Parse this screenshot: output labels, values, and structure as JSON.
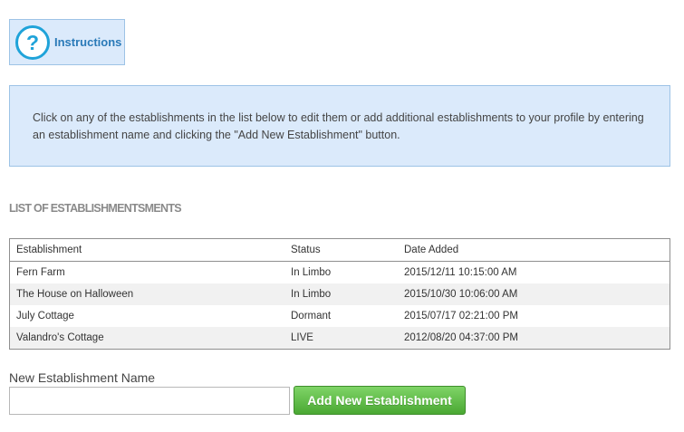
{
  "instructions": {
    "label": "Instructions",
    "icon": "help-question-icon"
  },
  "info_panel": {
    "text": "Click on any of the establishments in the list below to edit them or add additional establishments to your profile by entering an establishment name and clicking the \"Add New Establishment\" button."
  },
  "section_title": "LIST OF ESTABLISHMENTSMENTS",
  "table": {
    "headers": [
      "Establishment",
      "Status",
      "Date Added"
    ],
    "rows": [
      [
        "Fern Farm",
        "In Limbo",
        "2015/12/11 10:15:00 AM"
      ],
      [
        "The House on Halloween",
        "In Limbo",
        "2015/10/30 10:06:00 AM"
      ],
      [
        "July Cottage",
        "Dormant",
        "2015/07/17 02:21:00 PM"
      ],
      [
        "Valandro's Cottage",
        "LIVE",
        "2012/08/20 04:37:00 PM"
      ]
    ]
  },
  "form": {
    "label": "New Establishment Name",
    "input_value": "",
    "input_placeholder": "",
    "button_label": "Add New Establishment"
  },
  "colors": {
    "accent": "#2a7ab8",
    "panel_bg": "#dbeafb",
    "button_green": "#4aa833"
  }
}
